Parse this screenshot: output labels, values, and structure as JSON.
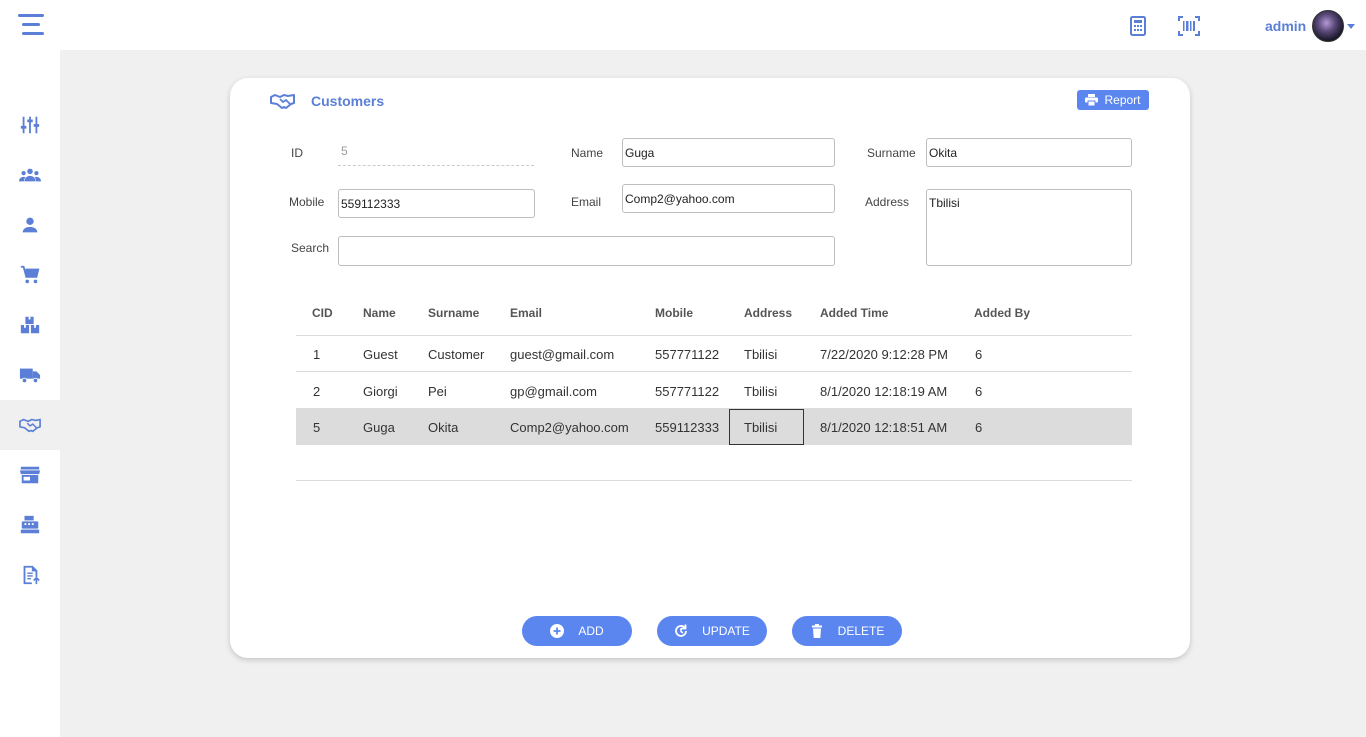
{
  "colors": {
    "accent": "#5b7fd6",
    "button": "#5b86f0",
    "selected_row": "#dcdcdc"
  },
  "header": {
    "menu_icon": "menu-icon",
    "icons": [
      "calculator-icon",
      "barcode-icon"
    ],
    "user": {
      "name": "admin",
      "avatar": "avatar-image",
      "caret": "chevron-down-icon"
    }
  },
  "sidebar": {
    "items": [
      {
        "icon": "sliders-icon",
        "active": false
      },
      {
        "icon": "group-icon",
        "active": false
      },
      {
        "icon": "user-icon",
        "active": false
      },
      {
        "icon": "cart-icon",
        "active": false
      },
      {
        "icon": "boxes-icon",
        "active": false
      },
      {
        "icon": "truck-icon",
        "active": false
      },
      {
        "icon": "handshake-icon",
        "active": true
      },
      {
        "icon": "store-icon",
        "active": false
      },
      {
        "icon": "cash-register-icon",
        "active": false
      },
      {
        "icon": "file-upload-icon",
        "active": false
      }
    ]
  },
  "page": {
    "title": "Customers",
    "report_label": "Report"
  },
  "form": {
    "id_label": "ID",
    "id_value": "5",
    "name_label": "Name",
    "name_value": "Guga",
    "surname_label": "Surname",
    "surname_value": "Okita",
    "mobile_label": "Mobile",
    "mobile_value": "559112333",
    "email_label": "Email",
    "email_value": "Comp2@yahoo.com",
    "address_label": "Address",
    "address_value": "Tbilisi",
    "search_label": "Search",
    "search_value": ""
  },
  "table": {
    "columns": [
      "CID",
      "Name",
      "Surname",
      "Email",
      "Mobile",
      "Address",
      "Added Time",
      "Added By"
    ],
    "rows": [
      {
        "cid": "1",
        "name": "Guest",
        "surname": "Customer",
        "email": "guest@gmail.com",
        "mobile": "557771122",
        "address": "Tbilisi",
        "added_time": "7/22/2020 9:12:28 PM",
        "added_by": "6"
      },
      {
        "cid": "2",
        "name": "Giorgi",
        "surname": "Pei",
        "email": "gp@gmail.com",
        "mobile": "557771122",
        "address": "Tbilisi",
        "added_time": "8/1/2020 12:18:19 AM",
        "added_by": "6"
      },
      {
        "cid": "5",
        "name": "Guga",
        "surname": "Okita",
        "email": "Comp2@yahoo.com",
        "mobile": "559112333",
        "address": "Tbilisi",
        "added_time": "8/1/2020 12:18:51 AM",
        "added_by": "6"
      }
    ],
    "selected_row": 2
  },
  "actions": {
    "add_label": "ADD",
    "update_label": "UPDATE",
    "delete_label": "DELETE"
  }
}
